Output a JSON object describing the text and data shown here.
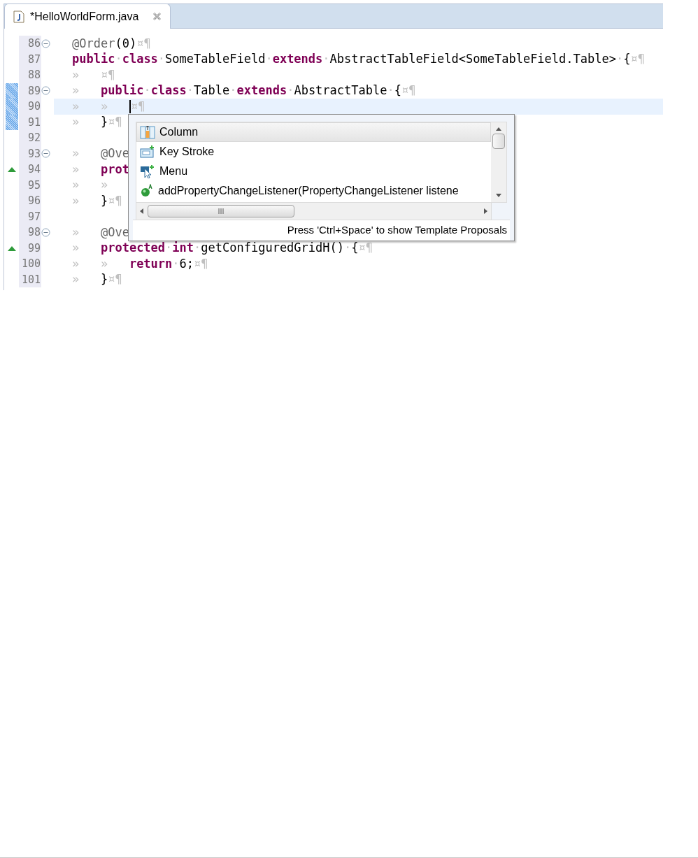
{
  "tab": {
    "title": "*HelloWorldForm.java",
    "selected": true
  },
  "lines": [
    {
      "number": "86",
      "fold": true,
      "override": false,
      "changed": false,
      "tokens": [
        {
          "kind": "ann",
          "text": "@Order"
        },
        {
          "kind": "text",
          "text": "(0)"
        },
        {
          "kind": "ws",
          "text": "¤¶"
        }
      ]
    },
    {
      "number": "87",
      "fold": false,
      "override": false,
      "changed": false,
      "tokens": [
        {
          "kind": "kw",
          "text": "public"
        },
        {
          "kind": "ws",
          "text": "·"
        },
        {
          "kind": "kw",
          "text": "class"
        },
        {
          "kind": "ws",
          "text": "·"
        },
        {
          "kind": "text",
          "text": "SomeTableField"
        },
        {
          "kind": "ws",
          "text": "·"
        },
        {
          "kind": "kw",
          "text": "extends"
        },
        {
          "kind": "ws",
          "text": "·"
        },
        {
          "kind": "text",
          "text": "AbstractTableField<SomeTableField.Table>"
        },
        {
          "kind": "ws",
          "text": "·"
        },
        {
          "kind": "text",
          "text": "{"
        },
        {
          "kind": "ws",
          "text": "¤¶"
        }
      ]
    },
    {
      "number": "88",
      "fold": false,
      "override": false,
      "changed": false,
      "tokens": [
        {
          "kind": "ws",
          "text": "»   ¤¶"
        }
      ]
    },
    {
      "number": "89",
      "fold": true,
      "override": false,
      "changed": true,
      "tokens": [
        {
          "kind": "ws",
          "text": "»   "
        },
        {
          "kind": "kw",
          "text": "public"
        },
        {
          "kind": "ws",
          "text": "·"
        },
        {
          "kind": "kw",
          "text": "class"
        },
        {
          "kind": "ws",
          "text": "·"
        },
        {
          "kind": "text",
          "text": "Table"
        },
        {
          "kind": "ws",
          "text": "·"
        },
        {
          "kind": "kw",
          "text": "extends"
        },
        {
          "kind": "ws",
          "text": "·"
        },
        {
          "kind": "text",
          "text": "AbstractTable"
        },
        {
          "kind": "ws",
          "text": "·"
        },
        {
          "kind": "text",
          "text": "{"
        },
        {
          "kind": "ws",
          "text": "¤¶"
        }
      ]
    },
    {
      "number": "90",
      "fold": false,
      "override": false,
      "changed": true,
      "current": true,
      "tokens": [
        {
          "kind": "ws",
          "text": "»   »   "
        },
        {
          "kind": "caret"
        },
        {
          "kind": "ws",
          "text": "¤¶"
        }
      ]
    },
    {
      "number": "91",
      "fold": false,
      "override": false,
      "changed": true,
      "tokens": [
        {
          "kind": "ws",
          "text": "»   "
        },
        {
          "kind": "text",
          "text": "}"
        },
        {
          "kind": "ws",
          "text": "¤¶"
        }
      ]
    },
    {
      "number": "92",
      "fold": false,
      "override": false,
      "changed": false
    },
    {
      "number": "93",
      "fold": true,
      "override": false,
      "changed": false,
      "tokens": [
        {
          "kind": "ws",
          "text": "»   "
        },
        {
          "kind": "ann",
          "text": "@Ove"
        }
      ]
    },
    {
      "number": "94",
      "fold": false,
      "override": true,
      "changed": false,
      "tokens": [
        {
          "kind": "ws",
          "text": "»   "
        },
        {
          "kind": "kw",
          "text": "prot"
        }
      ]
    },
    {
      "number": "95",
      "fold": false,
      "override": false,
      "changed": false,
      "tokens": [
        {
          "kind": "ws",
          "text": "»   »"
        }
      ]
    },
    {
      "number": "96",
      "fold": false,
      "override": false,
      "changed": false,
      "tokens": [
        {
          "kind": "ws",
          "text": "»   "
        },
        {
          "kind": "text",
          "text": "}"
        },
        {
          "kind": "ws",
          "text": "¤¶"
        }
      ]
    },
    {
      "number": "97",
      "fold": false,
      "override": false,
      "changed": false
    },
    {
      "number": "98",
      "fold": true,
      "override": false,
      "changed": false,
      "tokens": [
        {
          "kind": "ws",
          "text": "»   "
        },
        {
          "kind": "ann",
          "text": "@Ove"
        }
      ]
    },
    {
      "number": "99",
      "fold": false,
      "override": true,
      "changed": false,
      "tokens": [
        {
          "kind": "ws",
          "text": "»   "
        },
        {
          "kind": "kw",
          "text": "protected"
        },
        {
          "kind": "ws",
          "text": "·"
        },
        {
          "kind": "kw",
          "text": "int"
        },
        {
          "kind": "ws",
          "text": "·"
        },
        {
          "kind": "text",
          "text": "getConfiguredGridH()"
        },
        {
          "kind": "ws",
          "text": "·"
        },
        {
          "kind": "text",
          "text": "{"
        },
        {
          "kind": "ws",
          "text": "¤¶"
        }
      ]
    },
    {
      "number": "100",
      "fold": false,
      "override": false,
      "changed": false,
      "tokens": [
        {
          "kind": "ws",
          "text": "»   »   "
        },
        {
          "kind": "kw",
          "text": "return"
        },
        {
          "kind": "ws",
          "text": "·"
        },
        {
          "kind": "text",
          "text": "6;"
        },
        {
          "kind": "ws",
          "text": "¤¶"
        }
      ]
    },
    {
      "number": "101",
      "fold": false,
      "override": false,
      "changed": false,
      "tokens": [
        {
          "kind": "ws",
          "text": "»   "
        },
        {
          "kind": "text",
          "text": "}"
        },
        {
          "kind": "ws",
          "text": "¤¶"
        }
      ]
    }
  ],
  "proposals": {
    "items": [
      {
        "kind": "column",
        "label": "Column",
        "selected": true
      },
      {
        "kind": "keystroke",
        "label": "Key Stroke",
        "selected": false
      },
      {
        "kind": "menu",
        "label": "Menu",
        "selected": false
      },
      {
        "kind": "method",
        "label": "addPropertyChangeListener(PropertyChangeListener listene",
        "selected": false
      }
    ],
    "status": "Press 'Ctrl+Space' to show Template Proposals"
  }
}
